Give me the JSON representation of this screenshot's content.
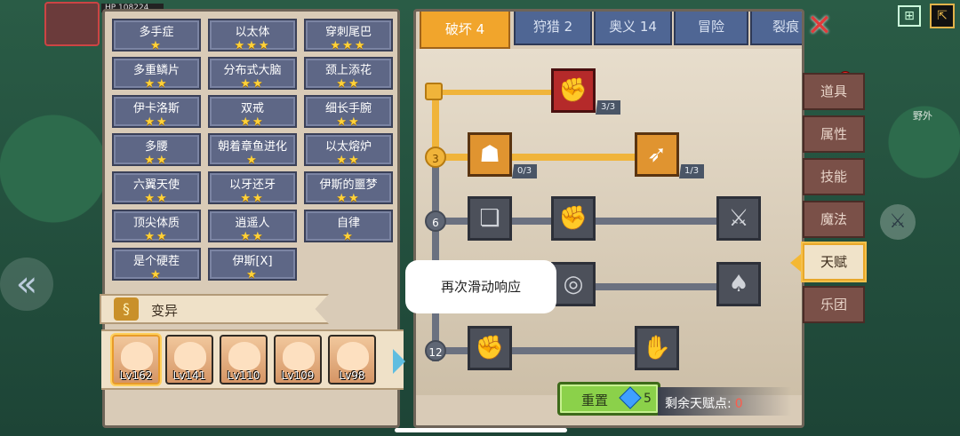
{
  "hud": {
    "hp_label": "HP 108224"
  },
  "traits": [
    {
      "name": "多手症",
      "stars": "★"
    },
    {
      "name": "以太体",
      "stars": "★★★"
    },
    {
      "name": "穿刺尾巴",
      "stars": "★★★"
    },
    {
      "name": "多重鳞片",
      "stars": "★★"
    },
    {
      "name": "分布式大脑",
      "stars": "★★"
    },
    {
      "name": "颈上添花",
      "stars": "★★"
    },
    {
      "name": "伊卡洛斯",
      "stars": "★★"
    },
    {
      "name": "双戒",
      "stars": "★★"
    },
    {
      "name": "细长手腕",
      "stars": "★★"
    },
    {
      "name": "多腰",
      "stars": "★★"
    },
    {
      "name": "朝着章鱼进化",
      "stars": "★"
    },
    {
      "name": "以太熔炉",
      "stars": "★★"
    },
    {
      "name": "六翼天使",
      "stars": "★★"
    },
    {
      "name": "以牙还牙",
      "stars": "★★"
    },
    {
      "name": "伊斯的噩梦",
      "stars": "★★"
    },
    {
      "name": "顶尖体质",
      "stars": "★★"
    },
    {
      "name": "逍遥人",
      "stars": "★★"
    },
    {
      "name": "自律",
      "stars": "★"
    },
    {
      "name": "是个硬茬",
      "stars": "★"
    },
    {
      "name": "伊斯[X]",
      "stars": "★"
    }
  ],
  "mutation": {
    "label": "变异"
  },
  "heroes": [
    {
      "level": "Lv162"
    },
    {
      "level": "Lv141"
    },
    {
      "level": "Lv110"
    },
    {
      "level": "Lv109"
    },
    {
      "level": "Lv98"
    }
  ],
  "tabs": [
    {
      "label": "破坏 4"
    },
    {
      "label": "狩猎 2"
    },
    {
      "label": "奥义 14"
    },
    {
      "label": "冒险"
    },
    {
      "label": "裂痕"
    }
  ],
  "tiers": [
    "3",
    "6",
    "12"
  ],
  "nodes": {
    "top": {
      "progress": "3/3"
    },
    "body": {
      "progress": "0/3"
    },
    "arrow": {
      "progress": "1/3"
    }
  },
  "tooltip": {
    "text": "再次滑动响应"
  },
  "reset": {
    "label": "重置",
    "cost": "5"
  },
  "points": {
    "label": "剩余天赋点:",
    "value": "0"
  },
  "side_menu": [
    {
      "label": "道具"
    },
    {
      "label": "属性"
    },
    {
      "label": "技能"
    },
    {
      "label": "魔法"
    },
    {
      "label": "天赋"
    },
    {
      "label": "乐团"
    }
  ],
  "map": {
    "area_label": "野外"
  }
}
